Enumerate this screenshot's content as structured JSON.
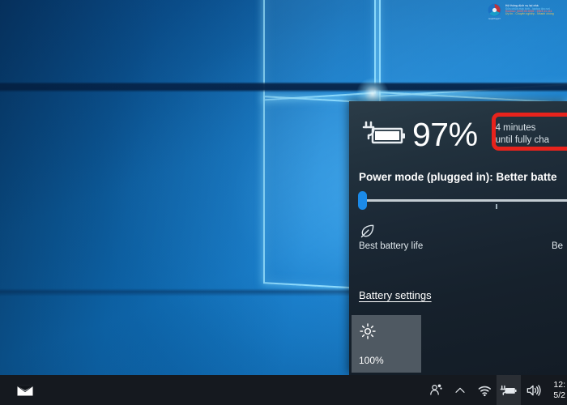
{
  "desktop": {
    "wallpaper_name": "windows-10-hero-wallpaper",
    "accent_color": "#1179c6"
  },
  "watermark": {
    "brand": "GiaiPhapIT",
    "line1": "Hệ thống dịch vụ tại nhà",
    "line2": "Sửa chữa máy tính - laptop tận nơi",
    "line3": "Hotline: 0909.00.0000 - 0909.11.111",
    "line4": "Uy tín - Chuyên nghiệp - Nhanh chóng"
  },
  "flyout": {
    "name": "battery-flyout",
    "battery_icon": "battery-charging-icon",
    "percent": "97%",
    "remaining_line1": "4 minutes",
    "remaining_line2": "until fully cha",
    "power_mode_label": "Power mode (plugged in): Better batte",
    "slider": {
      "name": "power-mode-slider",
      "value": 0,
      "min": 0,
      "max": 100,
      "thumb_color": "#1b8ae8",
      "track_color": "#c3ccd2"
    },
    "leaf_icon": "leaf-icon",
    "best_battery_label": "Best battery life",
    "best_performance_label": "Be",
    "settings_link": "Battery settings",
    "brightness": {
      "icon": "brightness-sun-icon",
      "value": "100%",
      "tile_color": "#4f5962"
    },
    "highlight_color": "#e8231c"
  },
  "taskbar": {
    "background": "#15191f",
    "left_items": [
      {
        "name": "mail-icon",
        "label": "Mail"
      }
    ],
    "tray_items": [
      {
        "name": "people-icon",
        "label": "People"
      },
      {
        "name": "chevron-up-icon",
        "label": "Show hidden icons"
      },
      {
        "name": "wifi-icon",
        "label": "Network"
      },
      {
        "name": "battery-icon",
        "label": "Battery",
        "active": true
      },
      {
        "name": "volume-icon",
        "label": "Volume"
      }
    ],
    "clock": {
      "time": "12:",
      "date": "5/2"
    }
  }
}
